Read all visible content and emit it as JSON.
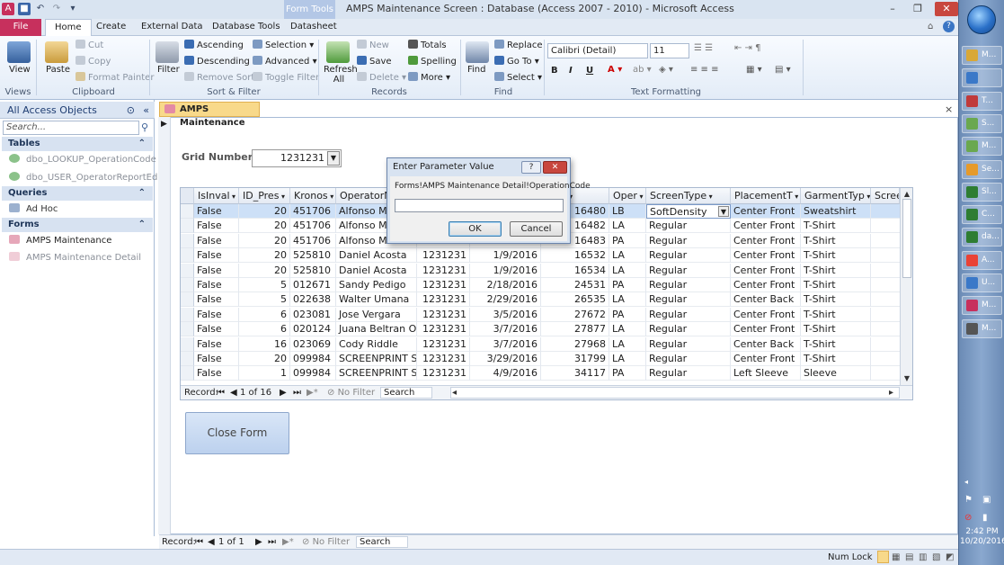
{
  "window": {
    "title": "AMPS Maintenance Screen : Database (Access 2007 - 2010)  -  Microsoft Access",
    "context_tab": "Form Tools"
  },
  "ribbon_tabs": [
    "File",
    "Home",
    "Create",
    "External Data",
    "Database Tools",
    "Datasheet"
  ],
  "ribbon": {
    "views": {
      "view": "View",
      "label": "Views"
    },
    "clipboard": {
      "paste": "Paste",
      "cut": "Cut",
      "copy": "Copy",
      "format_painter": "Format Painter",
      "label": "Clipboard"
    },
    "sort_filter": {
      "filter": "Filter",
      "ascending": "Ascending",
      "descending": "Descending",
      "remove_sort": "Remove Sort",
      "selection": "Selection",
      "advanced": "Advanced",
      "toggle_filter": "Toggle Filter",
      "label": "Sort & Filter"
    },
    "records": {
      "refresh_all": "Refresh All",
      "new": "New",
      "save": "Save",
      "delete": "Delete",
      "totals": "Totals",
      "spelling": "Spelling",
      "more": "More",
      "label": "Records"
    },
    "find": {
      "find": "Find",
      "replace": "Replace",
      "go_to": "Go To",
      "select": "Select",
      "label": "Find"
    },
    "text_formatting": {
      "font": "Calibri (Detail)",
      "size": "11",
      "label": "Text Formatting"
    }
  },
  "nav": {
    "header": "All Access Objects",
    "search_placeholder": "Search...",
    "sections": [
      {
        "name": "Tables",
        "items": [
          "dbo_LOOKUP_OperationCode",
          "dbo_USER_OperatorReportEdit"
        ]
      },
      {
        "name": "Queries",
        "items": [
          "Ad Hoc"
        ]
      },
      {
        "name": "Forms",
        "items": [
          "AMPS Maintenance",
          "AMPS Maintenance Detail"
        ]
      }
    ]
  },
  "document": {
    "tab": "AMPS Maintenance",
    "grid_label": "Grid Number:",
    "grid_value": "1231231",
    "close_form": "Close Form"
  },
  "datasheet": {
    "columns": [
      "IsInval",
      "ID_Pres",
      "Kronos",
      "OperatorN",
      "",
      "",
      "vent",
      "Oper",
      "ScreenType",
      "PlacementT",
      "GarmentTyp",
      "Scree"
    ],
    "rows": [
      [
        "False",
        "20",
        "451706",
        "Alfonso Ma",
        "",
        "",
        "16480",
        "LB",
        "SoftDensity",
        "Center Front",
        "Sweatshirt"
      ],
      [
        "False",
        "20",
        "451706",
        "Alfonso Ma",
        "",
        "",
        "16482",
        "LA",
        "Regular",
        "Center Front",
        "T-Shirt"
      ],
      [
        "False",
        "20",
        "451706",
        "Alfonso Ma",
        "",
        "",
        "16483",
        "PA",
        "Regular",
        "Center Front",
        "T-Shirt"
      ],
      [
        "False",
        "20",
        "525810",
        "Daniel Acosta",
        "1231231",
        "1/9/2016",
        "16532",
        "LA",
        "Regular",
        "Center Front",
        "T-Shirt"
      ],
      [
        "False",
        "20",
        "525810",
        "Daniel Acosta",
        "1231231",
        "1/9/2016",
        "16534",
        "LA",
        "Regular",
        "Center Front",
        "T-Shirt"
      ],
      [
        "False",
        "5",
        "012671",
        "Sandy Pedigo",
        "1231231",
        "2/18/2016",
        "24531",
        "PA",
        "Regular",
        "Center Front",
        "T-Shirt"
      ],
      [
        "False",
        "5",
        "022638",
        "Walter Umana",
        "1231231",
        "2/29/2016",
        "26535",
        "LA",
        "Regular",
        "Center Back",
        "T-Shirt"
      ],
      [
        "False",
        "6",
        "023081",
        "Jose Vergara",
        "1231231",
        "3/5/2016",
        "27672",
        "PA",
        "Regular",
        "Center Front",
        "T-Shirt"
      ],
      [
        "False",
        "6",
        "020124",
        "Juana Beltran Oc",
        "1231231",
        "3/7/2016",
        "27877",
        "LA",
        "Regular",
        "Center Front",
        "T-Shirt"
      ],
      [
        "False",
        "16",
        "023069",
        "Cody Riddle",
        "1231231",
        "3/7/2016",
        "27968",
        "LA",
        "Regular",
        "Center Back",
        "T-Shirt"
      ],
      [
        "False",
        "20",
        "099984",
        "SCREENPRINT SA",
        "1231231",
        "3/29/2016",
        "31799",
        "LA",
        "Regular",
        "Center Front",
        "T-Shirt"
      ],
      [
        "False",
        "1",
        "099984",
        "SCREENPRINT SA",
        "1231231",
        "4/9/2016",
        "34117",
        "PA",
        "Regular",
        "Left Sleeve",
        "Sleeve"
      ]
    ],
    "nav": {
      "record_label": "Record:",
      "position": "1 of 16",
      "no_filter": "No Filter",
      "search": "Search"
    }
  },
  "form_nav": {
    "record_label": "Record:",
    "position": "1 of 1",
    "no_filter": "No Filter",
    "search": "Search"
  },
  "dialog": {
    "title": "Enter Parameter Value",
    "prompt": "Forms!AMPS Maintenance Detail!OperationCode",
    "value": "",
    "ok": "OK",
    "cancel": "Cancel"
  },
  "status": {
    "num_lock": "Num Lock"
  },
  "taskbar": {
    "items": [
      "M...",
      "",
      "T...",
      "S...",
      "M...",
      "Se...",
      "Sl...",
      "C...",
      "da...",
      "A...",
      "U...",
      "M...",
      "M..."
    ],
    "time": "2:42 PM",
    "date": "10/20/2016"
  }
}
